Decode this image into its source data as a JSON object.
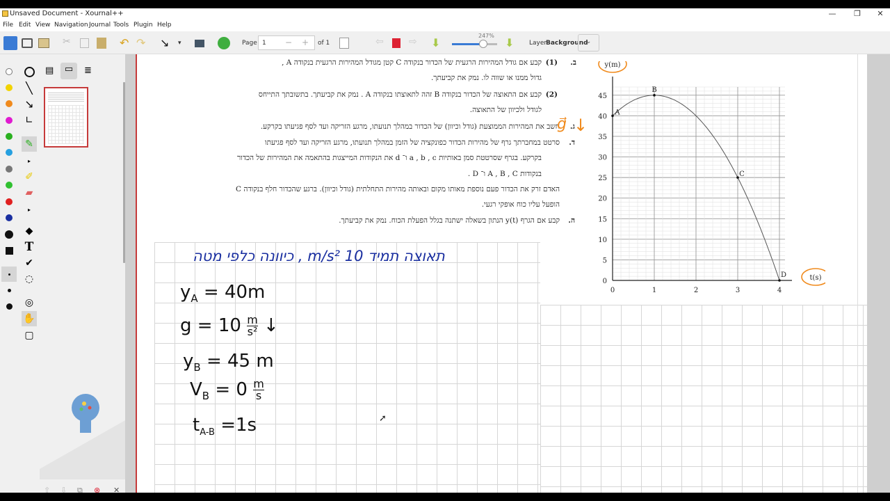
{
  "window": {
    "title": "Unsaved Document - Xournal++",
    "controls": [
      "—",
      "❐",
      "✕"
    ]
  },
  "menu": [
    "File",
    "Edit",
    "View",
    "Navigation",
    "Journal",
    "Tools",
    "Plugin",
    "Help"
  ],
  "toolbar": {
    "page_label": "Page",
    "page_value": "1",
    "of_label": "of 1",
    "zoom_label": "247%",
    "layer_label": "Layer",
    "layer_value": "Background"
  },
  "colors": {
    "accent_red": "#c63a3a",
    "pen_blue": "#1a2fa0",
    "pen_black": "#111111",
    "highlight_orange": "#f08a1c",
    "grid": "#c8c8c8"
  },
  "problem_text": {
    "line1": "קבע אם גודל המהירות הרגעית של הכדור בנקודה C קטן מגודל המהירות הרגעית בנקודה A ,",
    "line1_num": "(1)",
    "line1_letter": "ב.",
    "line2": "גדול ממנו או שווה לו. נמק את קביעתך.",
    "line3_num": "(2)",
    "line3": "קבע אם התאוצה של הכדור בנקודה B זהה לתאוצתו בנקודה A . נמק את קביעתך. בתשובתך התייחס",
    "line4": "לגודל ולכיוון של התאוצה.",
    "line5_letter": "ג.",
    "line5": "חשב את המהירות הממוצעת (גודל וכיוון) של הכדור במהלך תנועתו, מרגע הזריקה ועד לסף פגיעתו בקרקע.",
    "line6_letter": "ד.",
    "line6": "סרטט במחברתך גרף של מהירות הכדור כפונקציה של הזמן במהלך תנועתו, מרגע הזריקה ועד לסף פגיעתו",
    "line7": "בקרקע. בגרף שסרטטת סמן באותיות a , b , c ו־ d את הנקודות המייצגות בהתאמה את המהירות של הכדור",
    "line8": "בנקודות A , B , C ו־ D .",
    "line9": "האדם זרק את הכדור פעם נוספת מאותו מקום ובאותה מהירות התחלתית (גודל וכיוון). ברגע שהכדור חלף בנקודה C",
    "line10": "הופעל עליו כוח אופקי רגעי.",
    "line11_letter": "ה.",
    "line11": "קבע אם הגרף y(t) הנתון בשאלה ישתנה בגלל הפעלת הכוח. נמק את קביעתך."
  },
  "handwriting": {
    "blue_line": "תאוצה תמיד 10 m/s² , כיוונה כלפי מטה",
    "g_vec": "g⃗",
    "ya_label": "y",
    "ya_sub": "A",
    "ya_val": "= 40m",
    "g_label": "g",
    "g_val": "= 10",
    "g_unit_num": "m",
    "g_unit_den": "s²",
    "g_arrow": "↓",
    "yb_label": "y",
    "yb_sub": "B",
    "yb_val": "= 45 m",
    "vb_label": "V",
    "vb_sub": "B",
    "vb_val": "= 0",
    "vb_unit_num": "m",
    "vb_unit_den": "s",
    "tab_label": "t",
    "tab_sub": "A-B",
    "tab_val": "=1s"
  },
  "chart_data": {
    "type": "line",
    "ylabel": "y(m)",
    "xlabel": "t(s)",
    "x_ticks": [
      "0",
      "1",
      "2",
      "3",
      "4"
    ],
    "y_ticks": [
      "0",
      "5",
      "10",
      "15",
      "20",
      "25",
      "30",
      "35",
      "40",
      "45"
    ],
    "xlim": [
      0,
      4.3
    ],
    "ylim": [
      0,
      47
    ],
    "grid": true,
    "points": [
      {
        "label": "A",
        "x": 0,
        "y": 40
      },
      {
        "label": "B",
        "x": 1,
        "y": 45
      },
      {
        "label": "C",
        "x": 3,
        "y": 25
      },
      {
        "label": "D",
        "x": 4,
        "y": 0
      }
    ],
    "series": [
      {
        "x": [
          0,
          0.5,
          1,
          1.5,
          2,
          2.5,
          3,
          3.5,
          4
        ],
        "y": [
          40,
          43.75,
          45,
          43.75,
          40,
          33.75,
          25,
          13.75,
          0
        ]
      }
    ]
  }
}
